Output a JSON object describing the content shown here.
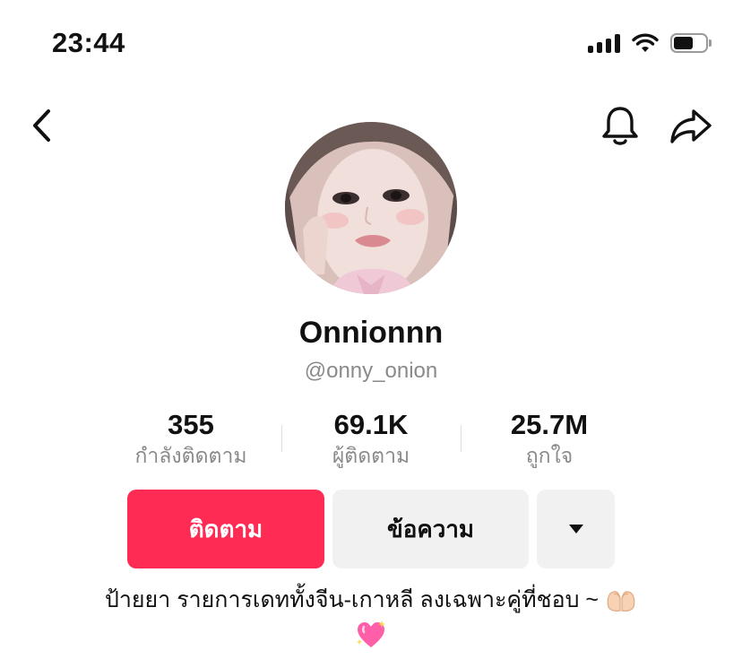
{
  "status_bar": {
    "time": "23:44",
    "icons": [
      "cellular-signal-icon",
      "wifi-icon",
      "battery-icon"
    ]
  },
  "nav": {
    "back_icon": "chevron-left-icon",
    "bell_icon": "bell-icon",
    "share_icon": "share-arrow-icon"
  },
  "profile": {
    "display_name": "Onnionnn",
    "username": "@onny_onion"
  },
  "stats": [
    {
      "value": "355",
      "label": "กำลังติดตาม"
    },
    {
      "value": "69.1K",
      "label": "ผู้ติดตาม"
    },
    {
      "value": "25.7M",
      "label": "ถูกใจ"
    }
  ],
  "actions": {
    "follow_label": "ติดตาม",
    "message_label": "ข้อความ",
    "more_icon": "caret-down-icon"
  },
  "bio": {
    "text": "ป้ายยา รายการเดททั้งจีน-เกาหลี ลงเฉพาะคู่ที่ชอบ ~",
    "emoji_1": "heart-hands-emoji",
    "emoji_2": "sparkling-heart-emoji"
  },
  "colors": {
    "accent": "#fe2c55",
    "secondary_button": "#f1f1f2",
    "muted_text": "#8a8a8a"
  }
}
